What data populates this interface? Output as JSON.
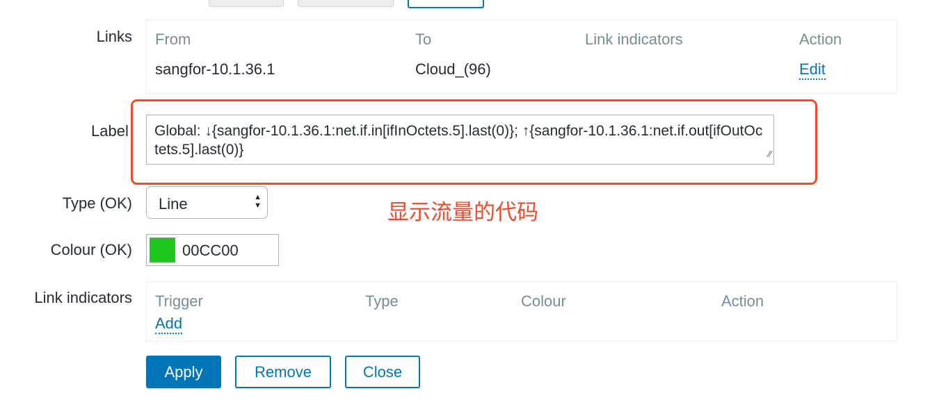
{
  "links": {
    "label": "Links",
    "headers": [
      "From",
      "To",
      "Link indicators",
      "Action"
    ],
    "rows": [
      {
        "from": "sangfor-10.1.36.1",
        "to": "Cloud_(96)",
        "indicators": "",
        "action": "Edit"
      }
    ]
  },
  "label_field": {
    "label": "Label",
    "value": "Global: ↓{sangfor-10.1.36.1:net.if.in[ifInOctets.5].last(0)}; ↑{sangfor-10.1.36.1:net.if.out[ifOutOctets.5].last(0)}"
  },
  "annotation": {
    "text": "显示流量的代码",
    "color": "#f04a2a"
  },
  "type_field": {
    "label": "Type (OK)",
    "value": "Line"
  },
  "colour_field": {
    "label": "Colour (OK)",
    "value": "00CC00",
    "swatch": "#1ec81e"
  },
  "link_indicators": {
    "label": "Link indicators",
    "headers": [
      "Trigger",
      "Type",
      "Colour",
      "Action"
    ],
    "add": "Add"
  },
  "buttons": {
    "apply": "Apply",
    "remove": "Remove",
    "close": "Close"
  }
}
